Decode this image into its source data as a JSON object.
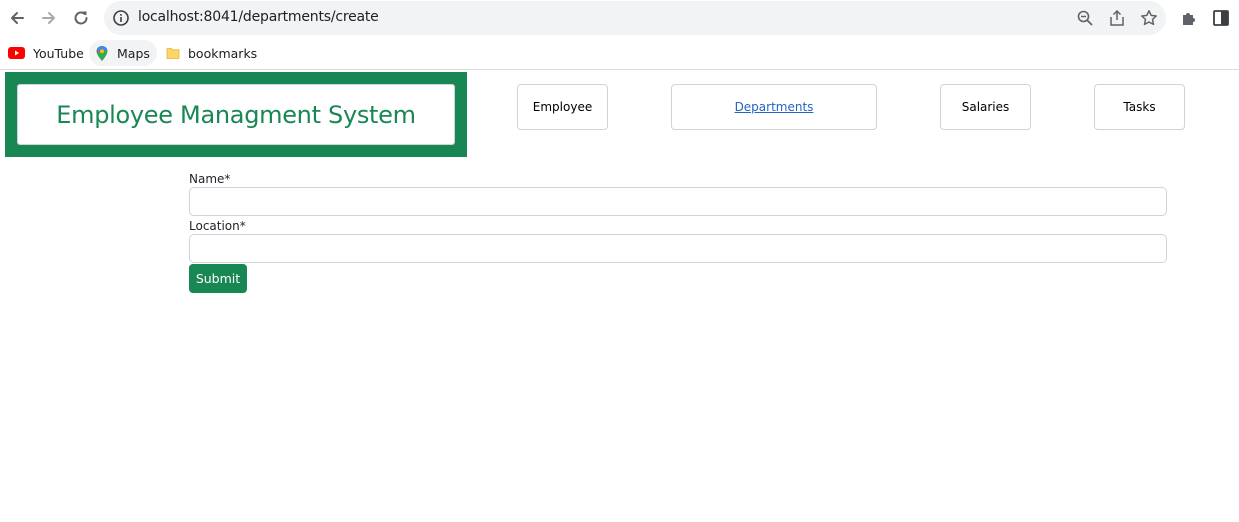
{
  "browser": {
    "url": "localhost:8041/departments/create"
  },
  "bookmarks": [
    {
      "label": "YouTube",
      "icon": "youtube-icon"
    },
    {
      "label": "Maps",
      "icon": "maps-icon"
    },
    {
      "label": "bookmarks",
      "icon": "folder-icon"
    }
  ],
  "header": {
    "brand": "Employee Managment System",
    "nav": [
      {
        "label": "Employee"
      },
      {
        "label": "Departments"
      },
      {
        "label": "Salaries"
      },
      {
        "label": "Tasks"
      }
    ]
  },
  "form": {
    "name_label": "Name*",
    "name_value": "",
    "location_label": "Location*",
    "location_value": "",
    "submit_label": "Submit"
  },
  "colors": {
    "brand": "#198754",
    "link": "#2563c6"
  }
}
